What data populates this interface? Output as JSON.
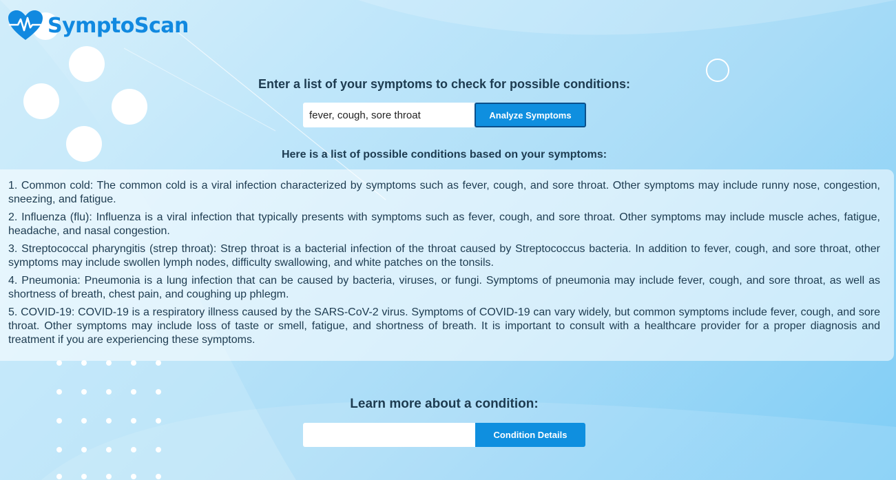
{
  "app": {
    "brand": "SymptoScan"
  },
  "symptom_check": {
    "heading": "Enter a list of your symptoms to check for possible conditions:",
    "input_value": "fever, cough, sore throat",
    "button_label": "Analyze Symptoms"
  },
  "results": {
    "heading": "Here is a list of possible conditions based on your symptoms:",
    "items": [
      "1. Common cold: The common cold is a viral infection characterized by symptoms such as fever, cough, and sore throat. Other symptoms may include runny nose, congestion, sneezing, and fatigue.",
      "2. Influenza (flu): Influenza is a viral infection that typically presents with symptoms such as fever, cough, and sore throat. Other symptoms may include muscle aches, fatigue, headache, and nasal congestion.",
      "3. Streptococcal pharyngitis (strep throat): Strep throat is a bacterial infection of the throat caused by Streptococcus bacteria. In addition to fever, cough, and sore throat, other symptoms may include swollen lymph nodes, difficulty swallowing, and white patches on the tonsils.",
      "4. Pneumonia: Pneumonia is a lung infection that can be caused by bacteria, viruses, or fungi. Symptoms of pneumonia may include fever, cough, and sore throat, as well as shortness of breath, chest pain, and coughing up phlegm.",
      "5. COVID-19: COVID-19 is a respiratory illness caused by the SARS-CoV-2 virus. Symptoms of COVID-19 can vary widely, but common symptoms include fever, cough, and sore throat. Other symptoms may include loss of taste or smell, fatigue, and shortness of breath. It is important to consult with a healthcare provider for a proper diagnosis and treatment if you are experiencing these symptoms."
    ]
  },
  "condition_lookup": {
    "heading": "Learn more about a condition:",
    "input_value": "",
    "button_label": "Condition Details"
  },
  "colors": {
    "brand": "#1189e0",
    "button": "#0f8fdf",
    "text": "#1d3b50"
  },
  "icons": {
    "logo": "heart-pulse-icon"
  }
}
